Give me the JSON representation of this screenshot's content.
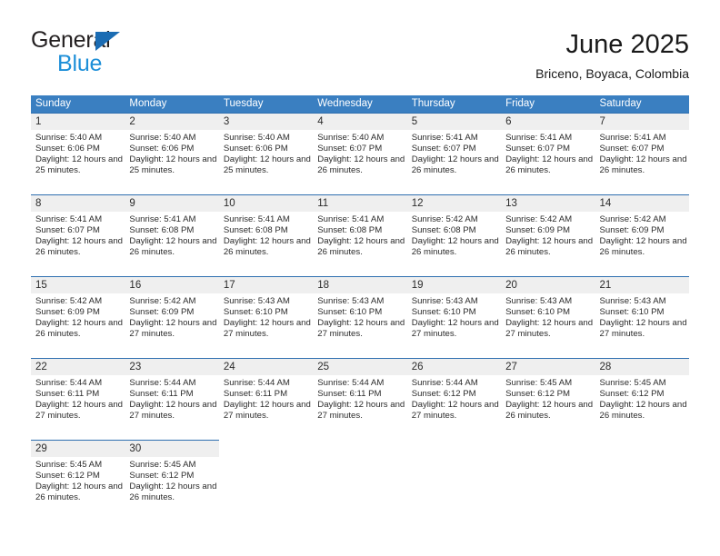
{
  "brand": {
    "name_part1": "General",
    "name_part2": "Blue",
    "triangle_color": "#1b6cb3",
    "blue_color": "#1d8fd8"
  },
  "header": {
    "title": "June 2025",
    "subtitle": "Briceno, Boyaca, Colombia"
  },
  "theme": {
    "header_bg": "#3a7fc1",
    "rule_color": "#2f6fb0",
    "daynum_bg": "#efefef",
    "text_color": "#2b2b2b"
  },
  "weekdays": [
    "Sunday",
    "Monday",
    "Tuesday",
    "Wednesday",
    "Thursday",
    "Friday",
    "Saturday"
  ],
  "weeks": [
    {
      "days": [
        {
          "num": "1",
          "sunrise": "Sunrise: 5:40 AM",
          "sunset": "Sunset: 6:06 PM",
          "daylight": "Daylight: 12 hours and 25 minutes."
        },
        {
          "num": "2",
          "sunrise": "Sunrise: 5:40 AM",
          "sunset": "Sunset: 6:06 PM",
          "daylight": "Daylight: 12 hours and 25 minutes."
        },
        {
          "num": "3",
          "sunrise": "Sunrise: 5:40 AM",
          "sunset": "Sunset: 6:06 PM",
          "daylight": "Daylight: 12 hours and 25 minutes."
        },
        {
          "num": "4",
          "sunrise": "Sunrise: 5:40 AM",
          "sunset": "Sunset: 6:07 PM",
          "daylight": "Daylight: 12 hours and 26 minutes."
        },
        {
          "num": "5",
          "sunrise": "Sunrise: 5:41 AM",
          "sunset": "Sunset: 6:07 PM",
          "daylight": "Daylight: 12 hours and 26 minutes."
        },
        {
          "num": "6",
          "sunrise": "Sunrise: 5:41 AM",
          "sunset": "Sunset: 6:07 PM",
          "daylight": "Daylight: 12 hours and 26 minutes."
        },
        {
          "num": "7",
          "sunrise": "Sunrise: 5:41 AM",
          "sunset": "Sunset: 6:07 PM",
          "daylight": "Daylight: 12 hours and 26 minutes."
        }
      ]
    },
    {
      "days": [
        {
          "num": "8",
          "sunrise": "Sunrise: 5:41 AM",
          "sunset": "Sunset: 6:07 PM",
          "daylight": "Daylight: 12 hours and 26 minutes."
        },
        {
          "num": "9",
          "sunrise": "Sunrise: 5:41 AM",
          "sunset": "Sunset: 6:08 PM",
          "daylight": "Daylight: 12 hours and 26 minutes."
        },
        {
          "num": "10",
          "sunrise": "Sunrise: 5:41 AM",
          "sunset": "Sunset: 6:08 PM",
          "daylight": "Daylight: 12 hours and 26 minutes."
        },
        {
          "num": "11",
          "sunrise": "Sunrise: 5:41 AM",
          "sunset": "Sunset: 6:08 PM",
          "daylight": "Daylight: 12 hours and 26 minutes."
        },
        {
          "num": "12",
          "sunrise": "Sunrise: 5:42 AM",
          "sunset": "Sunset: 6:08 PM",
          "daylight": "Daylight: 12 hours and 26 minutes."
        },
        {
          "num": "13",
          "sunrise": "Sunrise: 5:42 AM",
          "sunset": "Sunset: 6:09 PM",
          "daylight": "Daylight: 12 hours and 26 minutes."
        },
        {
          "num": "14",
          "sunrise": "Sunrise: 5:42 AM",
          "sunset": "Sunset: 6:09 PM",
          "daylight": "Daylight: 12 hours and 26 minutes."
        }
      ]
    },
    {
      "days": [
        {
          "num": "15",
          "sunrise": "Sunrise: 5:42 AM",
          "sunset": "Sunset: 6:09 PM",
          "daylight": "Daylight: 12 hours and 26 minutes."
        },
        {
          "num": "16",
          "sunrise": "Sunrise: 5:42 AM",
          "sunset": "Sunset: 6:09 PM",
          "daylight": "Daylight: 12 hours and 27 minutes."
        },
        {
          "num": "17",
          "sunrise": "Sunrise: 5:43 AM",
          "sunset": "Sunset: 6:10 PM",
          "daylight": "Daylight: 12 hours and 27 minutes."
        },
        {
          "num": "18",
          "sunrise": "Sunrise: 5:43 AM",
          "sunset": "Sunset: 6:10 PM",
          "daylight": "Daylight: 12 hours and 27 minutes."
        },
        {
          "num": "19",
          "sunrise": "Sunrise: 5:43 AM",
          "sunset": "Sunset: 6:10 PM",
          "daylight": "Daylight: 12 hours and 27 minutes."
        },
        {
          "num": "20",
          "sunrise": "Sunrise: 5:43 AM",
          "sunset": "Sunset: 6:10 PM",
          "daylight": "Daylight: 12 hours and 27 minutes."
        },
        {
          "num": "21",
          "sunrise": "Sunrise: 5:43 AM",
          "sunset": "Sunset: 6:10 PM",
          "daylight": "Daylight: 12 hours and 27 minutes."
        }
      ]
    },
    {
      "days": [
        {
          "num": "22",
          "sunrise": "Sunrise: 5:44 AM",
          "sunset": "Sunset: 6:11 PM",
          "daylight": "Daylight: 12 hours and 27 minutes."
        },
        {
          "num": "23",
          "sunrise": "Sunrise: 5:44 AM",
          "sunset": "Sunset: 6:11 PM",
          "daylight": "Daylight: 12 hours and 27 minutes."
        },
        {
          "num": "24",
          "sunrise": "Sunrise: 5:44 AM",
          "sunset": "Sunset: 6:11 PM",
          "daylight": "Daylight: 12 hours and 27 minutes."
        },
        {
          "num": "25",
          "sunrise": "Sunrise: 5:44 AM",
          "sunset": "Sunset: 6:11 PM",
          "daylight": "Daylight: 12 hours and 27 minutes."
        },
        {
          "num": "26",
          "sunrise": "Sunrise: 5:44 AM",
          "sunset": "Sunset: 6:12 PM",
          "daylight": "Daylight: 12 hours and 27 minutes."
        },
        {
          "num": "27",
          "sunrise": "Sunrise: 5:45 AM",
          "sunset": "Sunset: 6:12 PM",
          "daylight": "Daylight: 12 hours and 26 minutes."
        },
        {
          "num": "28",
          "sunrise": "Sunrise: 5:45 AM",
          "sunset": "Sunset: 6:12 PM",
          "daylight": "Daylight: 12 hours and 26 minutes."
        }
      ]
    },
    {
      "partial": true,
      "days": [
        {
          "num": "29",
          "sunrise": "Sunrise: 5:45 AM",
          "sunset": "Sunset: 6:12 PM",
          "daylight": "Daylight: 12 hours and 26 minutes."
        },
        {
          "num": "30",
          "sunrise": "Sunrise: 5:45 AM",
          "sunset": "Sunset: 6:12 PM",
          "daylight": "Daylight: 12 hours and 26 minutes."
        }
      ]
    }
  ]
}
